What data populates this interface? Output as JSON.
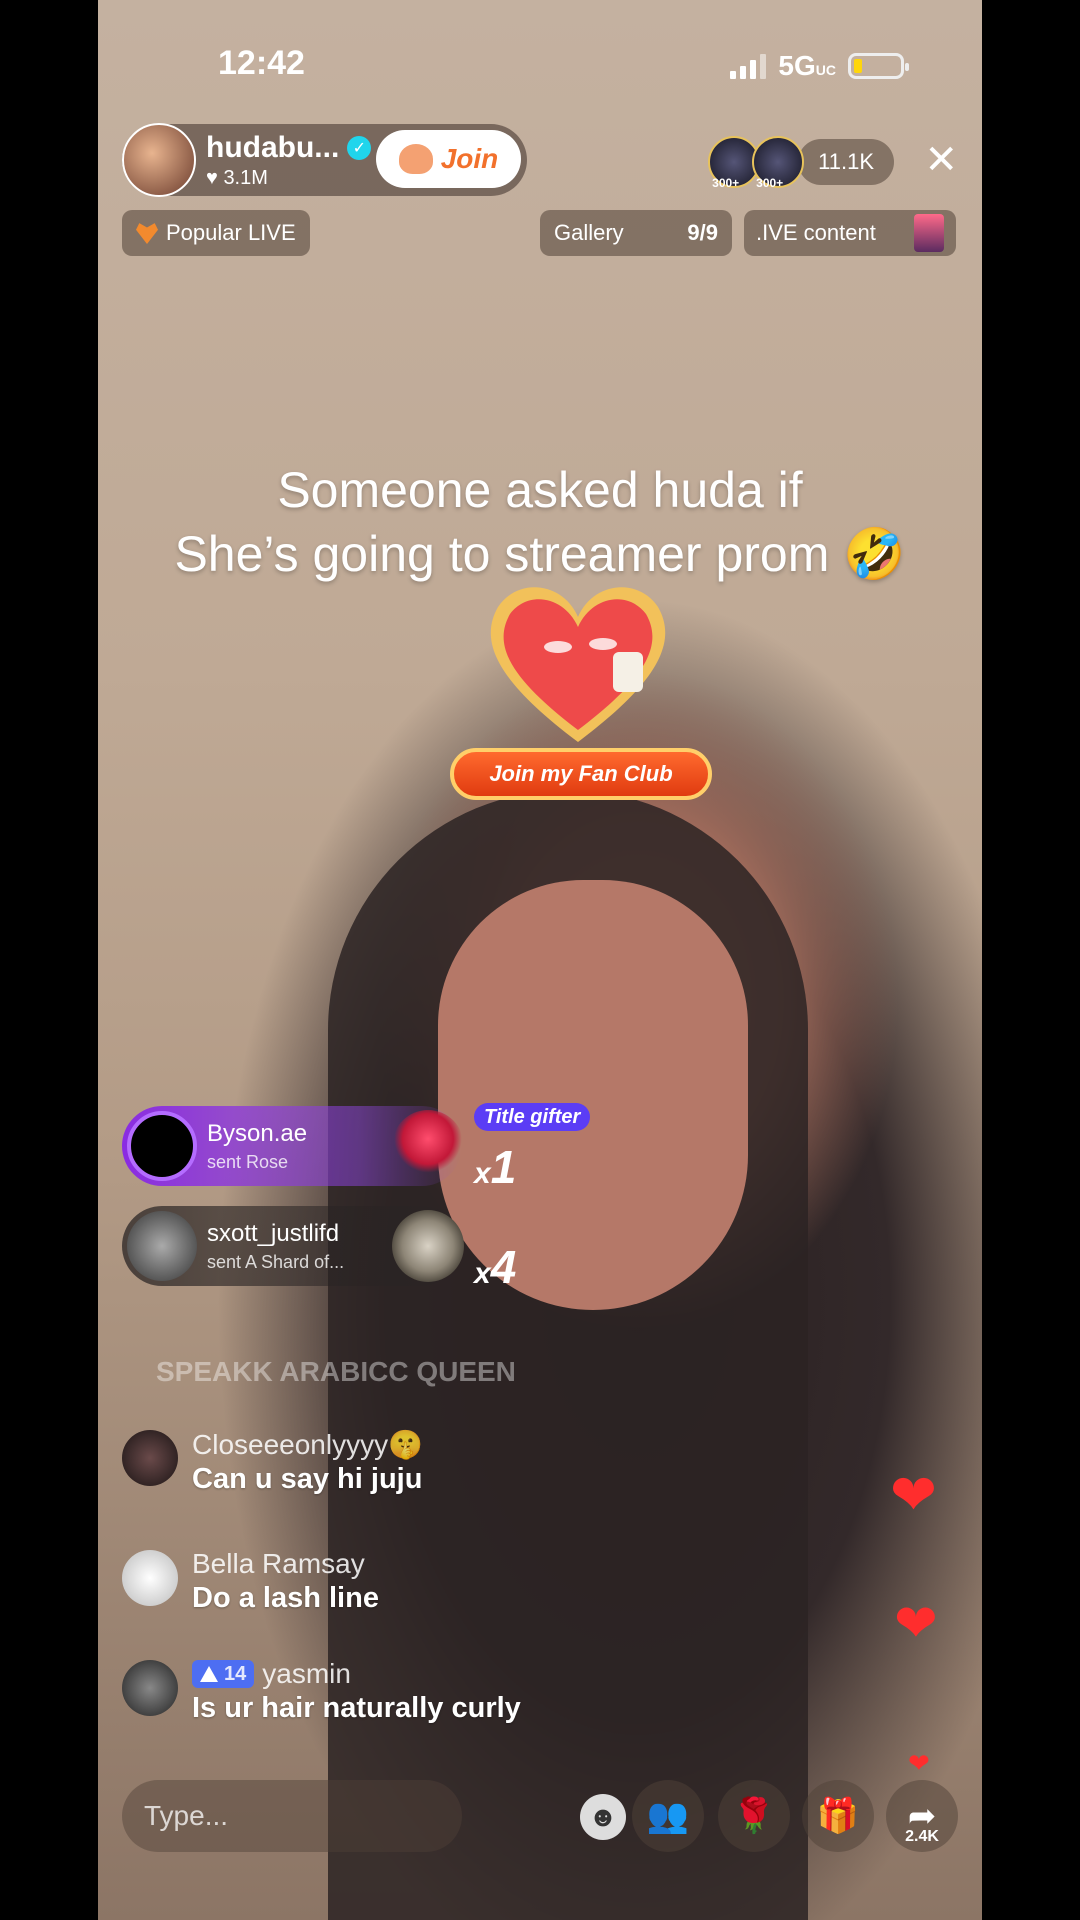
{
  "status": {
    "time": "12:42",
    "network": "5G",
    "network_suffix": "UC"
  },
  "host": {
    "name": "hudabu...",
    "likes": "3.1M",
    "join_label": "Join"
  },
  "viewers": {
    "badge1": "300+",
    "badge2": "300+",
    "count": "11.1K"
  },
  "pills": {
    "popular": "Popular LIVE",
    "gallery": "Gallery",
    "gallery_count": "9/9",
    "live_content": ".IVE content"
  },
  "caption": {
    "line1": "Someone asked huda if",
    "line2": "She’s going to streamer prom 🤣"
  },
  "fan_club": {
    "label": "Join my Fan Club"
  },
  "gifts": [
    {
      "user": "Byson.ae",
      "action": "sent Rose",
      "x": "x",
      "count": "1",
      "badge": "Title gifter"
    },
    {
      "user": "sxott_justlifd",
      "action": "sent A Shard of...",
      "x": "x",
      "count": "4"
    }
  ],
  "faded_comment": "SPEAKK ARABICC QUEEN",
  "comments": [
    {
      "user": "Closeeeonlyyyy🤫",
      "text": "Can u say hi juju"
    },
    {
      "user": "Bella Ramsay",
      "text": "Do a lash line"
    },
    {
      "user": "yasmin",
      "level": "14",
      "text": "Is ur hair naturally curly"
    }
  ],
  "bottom": {
    "placeholder": "Type...",
    "share_count": "2.4K"
  },
  "icons": {
    "heart": "❤",
    "close": "✕",
    "emoji": "☻",
    "rose": "🌹",
    "gift": "🎁",
    "share": "➦",
    "people": "👥"
  }
}
